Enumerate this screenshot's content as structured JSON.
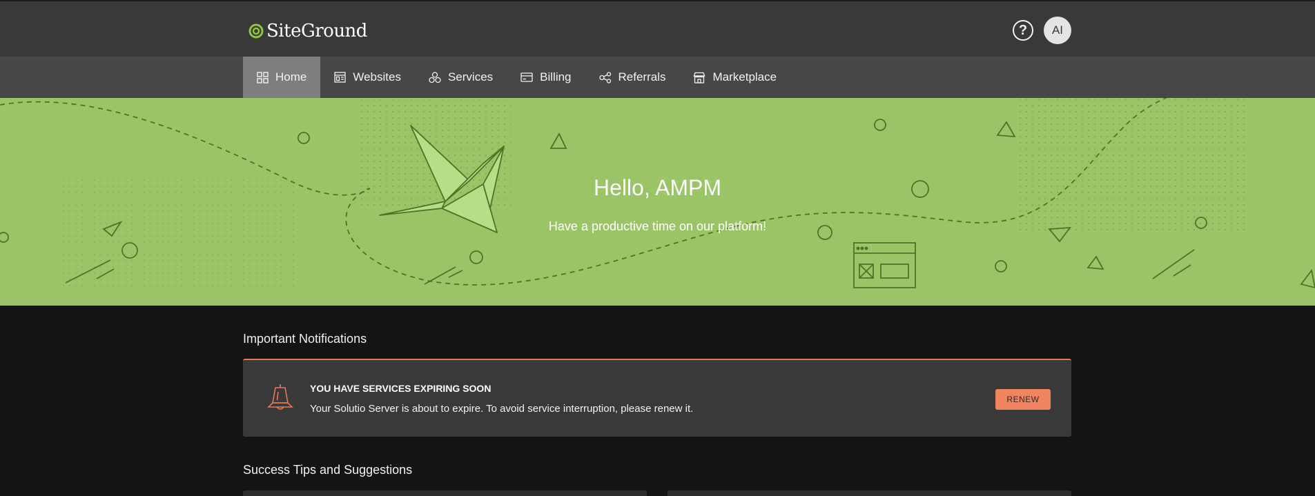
{
  "header": {
    "logo_text": "SiteGround",
    "help_icon": "question-icon",
    "avatar_initials": "AI"
  },
  "nav": {
    "items": [
      {
        "label": "Home",
        "icon": "grid-icon",
        "active": true
      },
      {
        "label": "Websites",
        "icon": "website-icon"
      },
      {
        "label": "Services",
        "icon": "services-icon"
      },
      {
        "label": "Billing",
        "icon": "card-icon"
      },
      {
        "label": "Referrals",
        "icon": "share-icon"
      },
      {
        "label": "Marketplace",
        "icon": "store-icon"
      }
    ]
  },
  "hero": {
    "title": "Hello, AMPM",
    "subtitle": "Have a productive time on our platform!"
  },
  "notifications": {
    "section_title": "Important Notifications",
    "card": {
      "icon": "bell-icon",
      "title": "YOU HAVE SERVICES EXPIRING SOON",
      "text": "Your Solutio Server is about to expire. To avoid service interruption, please renew it.",
      "button_label": "RENEW"
    }
  },
  "tips": {
    "section_title": "Success Tips and Suggestions"
  },
  "colors": {
    "hero_green": "#9bc466",
    "accent_orange": "#f0845f",
    "logo_green": "#8dc63f"
  }
}
